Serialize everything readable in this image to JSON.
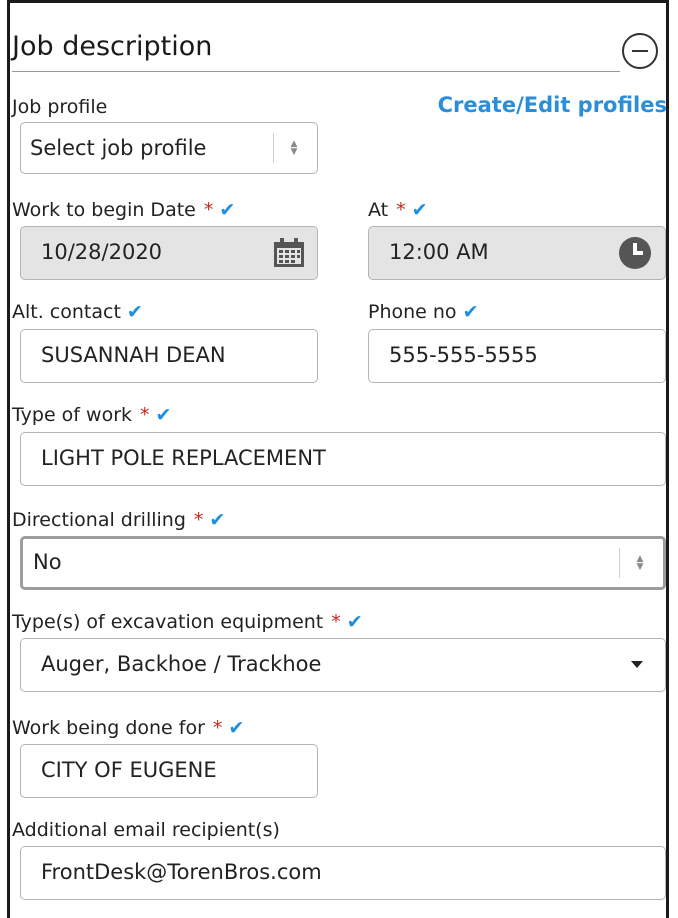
{
  "section": {
    "title": "Job description"
  },
  "job_profile": {
    "label": "Job profile",
    "link": "Create/Edit profiles",
    "value": "Select job profile"
  },
  "begin_date": {
    "label": "Work to begin Date",
    "required_mark": "*",
    "valid_mark": "✔",
    "value": "10/28/2020"
  },
  "begin_time": {
    "label": "At",
    "required_mark": "*",
    "valid_mark": "✔",
    "value": "12:00 AM"
  },
  "alt_contact": {
    "label": "Alt. contact",
    "valid_mark": "✔",
    "value": "SUSANNAH DEAN"
  },
  "phone": {
    "label": "Phone no",
    "valid_mark": "✔",
    "value": "555-555-5555"
  },
  "type_of_work": {
    "label": "Type of work",
    "required_mark": "*",
    "valid_mark": "✔",
    "value": "LIGHT POLE REPLACEMENT"
  },
  "directional_drilling": {
    "label": "Directional drilling",
    "required_mark": "*",
    "valid_mark": "✔",
    "value": "No"
  },
  "excavation_equipment": {
    "label": "Type(s) of excavation equipment",
    "required_mark": "*",
    "valid_mark": "✔",
    "value": "Auger, Backhoe / Trackhoe"
  },
  "done_for": {
    "label": "Work being done for",
    "required_mark": "*",
    "valid_mark": "✔",
    "value": "CITY OF EUGENE"
  },
  "email_recipients": {
    "label": "Additional email recipient(s)",
    "value": "FrontDesk@TorenBros.com"
  },
  "icons": {
    "collapse": "minus-circle-icon",
    "calendar": "calendar-icon",
    "clock": "clock-icon",
    "select_arrows": "up-down-arrows-icon",
    "dropdown": "caret-down-icon"
  },
  "colors": {
    "required": "#c0281e",
    "valid": "#1e8fe0",
    "link": "#2a8ed8",
    "disabled_bg": "#e4e4e4"
  }
}
